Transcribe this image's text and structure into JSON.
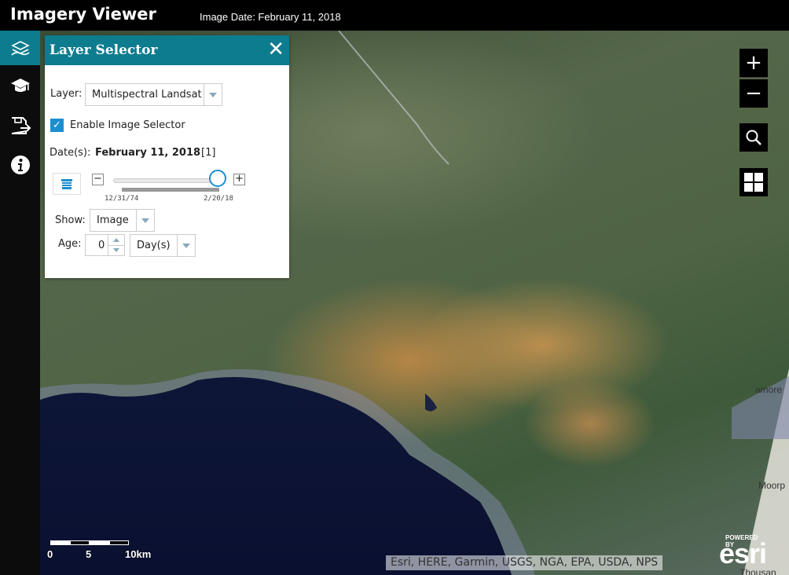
{
  "header": {
    "title": "Imagery Viewer",
    "image_date_label": "Image Date: February 11, 2018"
  },
  "toolbar": {
    "items": [
      {
        "icon": "layers-map-icon",
        "active": true
      },
      {
        "icon": "graduation-cap-icon",
        "active": false
      },
      {
        "icon": "save-export-icon",
        "active": false
      },
      {
        "icon": "info-icon",
        "active": false
      }
    ]
  },
  "panel": {
    "title": "Layer Selector",
    "layer_label": "Layer:",
    "layer_value": "Multispectral Landsat",
    "enable_selector_label": "Enable Image Selector",
    "enable_selector_checked": true,
    "dates_label": "Date(s):",
    "dates_value": "February 11, 2018",
    "dates_count": "[1]",
    "slider_min_label": "12/31/74",
    "slider_max_label": "2/20/18",
    "slider_value_fraction": 0.97,
    "show_label": "Show:",
    "show_value": "Image",
    "age_label": "Age:",
    "age_value": "0",
    "age_unit": "Day(s)"
  },
  "map": {
    "zoom_in": "+",
    "zoom_out": "−",
    "scale_labels": [
      "0",
      "5",
      "10km"
    ],
    "attribution": "Esri, HERE, Garmin, USGS, NGA, EPA, USDA, NPS",
    "esri_powered": "POWERED BY",
    "esri_logo": "esri",
    "places": [
      "amore",
      "Moorp",
      "Thousan"
    ]
  }
}
